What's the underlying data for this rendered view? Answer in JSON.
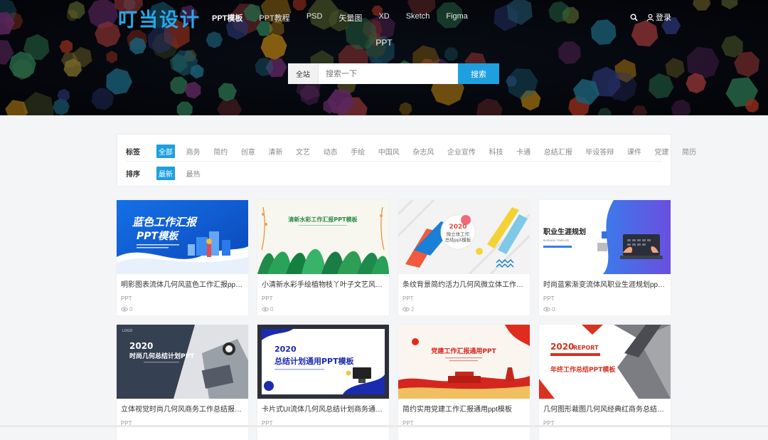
{
  "header": {
    "logo": "叮当设计",
    "nav": [
      "PPT模板",
      "PPT教程",
      "PSD",
      "矢量图",
      "XD",
      "Sketch",
      "Figma"
    ],
    "active_nav": 0,
    "search_icon": "search-icon",
    "login_label": "登录",
    "login_icon": "user-icon"
  },
  "hero": {
    "title": "PPT",
    "search": {
      "scope": "全站",
      "placeholder": "搜索一下",
      "button": "搜索"
    }
  },
  "filters": {
    "tags_label": "标签",
    "tags": [
      "全部",
      "商务",
      "简约",
      "创意",
      "清新",
      "文艺",
      "动态",
      "手绘",
      "中国风",
      "杂志风",
      "企业宣传",
      "科技",
      "卡通",
      "总结汇报",
      "毕设答辩",
      "课件",
      "党建",
      "简历"
    ],
    "active_tag": 0,
    "sort_label": "排序",
    "sorts": [
      "最新",
      "最热"
    ],
    "active_sort": 0
  },
  "cards": [
    {
      "title": "明影图表流体几何风蓝色工作汇报ppt模板",
      "category": "PPT",
      "views": "0",
      "thumb_text": [
        "蓝色工作汇报",
        "PPT模板"
      ]
    },
    {
      "title": "小清新水彩手绘植物枝丫叶子文艺风工作汇报",
      "category": "PPT",
      "views": "0",
      "thumb_text": [
        "清新水彩工作汇报PPT模板"
      ]
    },
    {
      "title": "条纹背景简约活力几何风微立体工作汇报ppt模板",
      "category": "PPT",
      "views": "2",
      "thumb_text": [
        "2020",
        "微立体工作",
        "总结ppt模板"
      ]
    },
    {
      "title": "时尚蓝紫渐变流体风职业生涯规划ppt模板",
      "category": "PPT",
      "views": "0",
      "thumb_text": [
        "职业生涯规划",
        "BUSINESS TEMPLATE"
      ]
    },
    {
      "title": "立体视觉时尚几何风商务工作总结报告ppt模板",
      "category": "PPT",
      "views": "",
      "thumb_text": [
        "LOGO",
        "2020",
        "时尚几何总结计划PPT"
      ]
    },
    {
      "title": "卡片式UI流体几何风总结计划商务通用ppt模板",
      "category": "PPT",
      "views": "",
      "thumb_text": [
        "2020",
        "总结计划通用PPT模板"
      ]
    },
    {
      "title": "简约实用党建工作汇报通用ppt模板",
      "category": "PPT",
      "views": "",
      "thumb_text": [
        "党建工作汇报通用PPT"
      ]
    },
    {
      "title": "几何图形裁图几何风经典红商务总结汇报ppt模板",
      "category": "PPT",
      "views": "",
      "thumb_text": [
        "2020",
        "REPORT",
        "年终工作总结PPT模板"
      ]
    }
  ],
  "colors": {
    "accent": "#1e9fe0",
    "logo": "#2aa7ea"
  }
}
